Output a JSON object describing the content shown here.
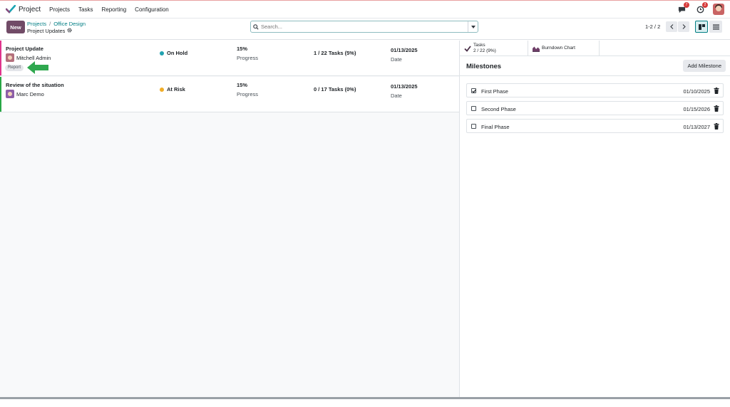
{
  "app": {
    "name": "Project"
  },
  "nav": {
    "items": [
      "Projects",
      "Tasks",
      "Reporting",
      "Configuration"
    ]
  },
  "header": {
    "messages_count": "7",
    "activities_count": "2"
  },
  "control": {
    "new_label": "New",
    "breadcrumb": [
      "Projects",
      "Office Design"
    ],
    "breadcrumb_sep": "/",
    "page_title": "Project Updates",
    "search_placeholder": "Search...",
    "pager": "1-2 / 2"
  },
  "updates": [
    {
      "title": "Project Update",
      "author": "Mitchell Admin",
      "tag": "Report",
      "status": "On Hold",
      "status_color": "#21a2b0",
      "progress": "15%",
      "progress_label": "Progress",
      "tasks": "1 / 22 Tasks (5%)",
      "date": "01/13/2025",
      "date_label": "Date",
      "bar_color": "#e0348c"
    },
    {
      "title": "Review of the situation",
      "author": "Marc Demo",
      "status": "At Risk",
      "status_color": "#f0ad28",
      "progress": "15%",
      "progress_label": "Progress",
      "tasks": "0 / 17 Tasks (0%)",
      "date": "01/13/2025",
      "date_label": "Date",
      "bar_color": "#28a745"
    }
  ],
  "panel": {
    "tasks_label": "Tasks",
    "tasks_value": "2 / 22 (9%)",
    "burndown_label": "Burndown Chart",
    "milestones_title": "Milestones",
    "add_milestone_label": "Add Milestone",
    "milestones": [
      {
        "name": "First Phase",
        "date": "01/10/2025",
        "done": true
      },
      {
        "name": "Second Phase",
        "date": "01/15/2026",
        "done": false
      },
      {
        "name": "Final Phase",
        "date": "01/13/2027",
        "done": false
      }
    ]
  },
  "colors": {
    "brand": "#714b67",
    "link": "#017e84",
    "arrow": "#2fa84f"
  }
}
